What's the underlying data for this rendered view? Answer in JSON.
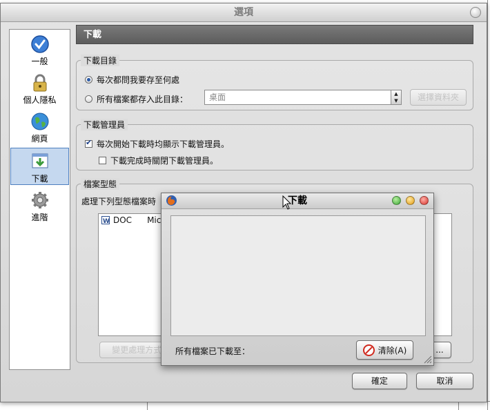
{
  "window": {
    "title": "選項"
  },
  "sidebar": {
    "items": [
      {
        "label": "一般",
        "icon": "checkmark-icon"
      },
      {
        "label": "個人隱私",
        "icon": "lock-icon"
      },
      {
        "label": "網頁",
        "icon": "globe-icon"
      },
      {
        "label": "下載",
        "icon": "download-icon",
        "selected": true
      },
      {
        "label": "進階",
        "icon": "gear-icon"
      }
    ]
  },
  "content": {
    "header": "下載",
    "download_folder": {
      "legend": "下載目錄",
      "ask_label": "每次都問我要存至何處",
      "save_to_label": "所有檔案都存入此目錄：",
      "folder_value": "桌面",
      "browse_label": "選擇資料夾"
    },
    "download_manager": {
      "legend": "下載管理員",
      "show_label": "每次開始下載時均顯示下載管理員。",
      "close_label": "下載完成時關閉下載管理員。"
    },
    "file_types": {
      "legend": "檔案型態",
      "desc": "處理下列型態檔案時",
      "rows": [
        {
          "ext": "DOC",
          "desc": "Micr"
        }
      ],
      "edit_label": "變更處理方式...",
      "more_label": "...",
      "more_suffix": "..."
    }
  },
  "footer": {
    "ok": "確定",
    "cancel": "取消"
  },
  "downloads_window": {
    "title": "下載",
    "saved_to": "所有檔案已下載至：",
    "clear_label": "清除(A)"
  }
}
